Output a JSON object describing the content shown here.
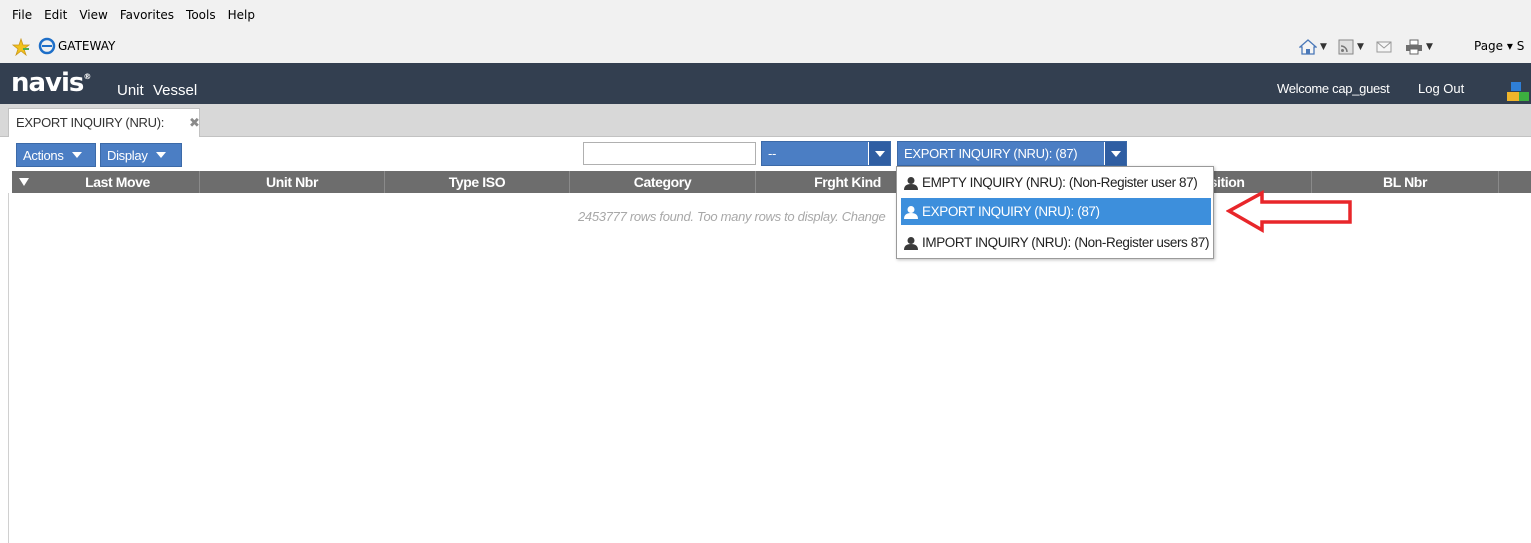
{
  "browser": {
    "menu": [
      "File",
      "Edit",
      "View",
      "Favorites",
      "Tools",
      "Help"
    ],
    "tab_title": "GATEWAY",
    "page_menu": "Page ▾ S"
  },
  "app": {
    "logo": "navis",
    "nav": [
      "Unit",
      "Vessel"
    ],
    "welcome": "Welcome cap_guest",
    "logout": "Log Out"
  },
  "tab": {
    "label": "EXPORT INQUIRY (NRU):",
    "close": "✖"
  },
  "toolbar": {
    "actions": "Actions",
    "display": "Display",
    "search_value": "",
    "filter_value": "--",
    "inquiry_value": "EXPORT INQUIRY (NRU): (87)"
  },
  "grid": {
    "columns": [
      "Last Move",
      "Unit Nbr",
      "Type ISO",
      "Category",
      "Frght Kind",
      "",
      "Position",
      "BL Nbr",
      ""
    ],
    "message": "2453777 rows found. Too many rows to display. Change"
  },
  "dropdown": {
    "items": [
      {
        "label": "EMPTY INQUIRY (NRU): (Non-Register user 87)",
        "selected": false
      },
      {
        "label": "EXPORT INQUIRY (NRU): (87)",
        "selected": true
      },
      {
        "label": "IMPORT INQUIRY (NRU): (Non-Register users 87)",
        "selected": false
      }
    ]
  },
  "colors": {
    "header_bg": "#333f50",
    "button_blue": "#4b7ec4",
    "grid_header": "#6d6d6d",
    "selected_item": "#3d8fdc",
    "annotation_arrow": "#e8262a"
  }
}
